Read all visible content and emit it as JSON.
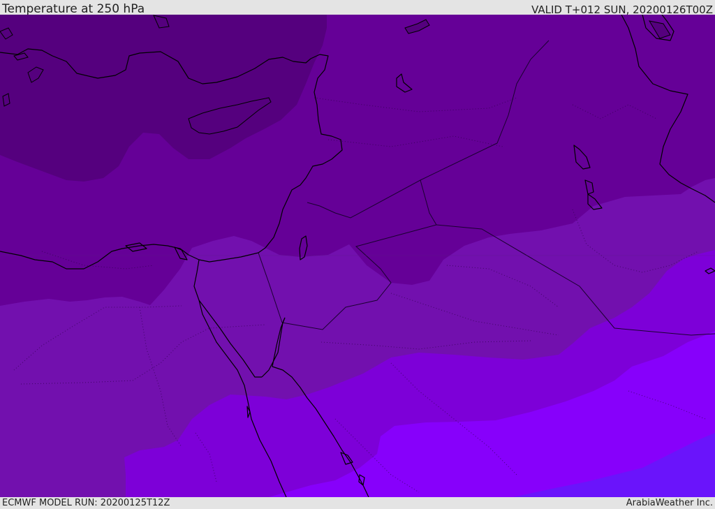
{
  "header": {
    "title": "Temperature at 250 hPa",
    "valid": "VALID T+012 SUN, 20200126T00Z"
  },
  "footer": {
    "model_run": "ECMWF MODEL RUN: 20200125T12Z",
    "credit": "ArabiaWeather Inc."
  },
  "map": {
    "field": "temperature",
    "level": "250 hPa",
    "region": "Eastern Mediterranean, Levant, Egypt and northern Arabia",
    "colors": {
      "band_1_coldest": "#55007e",
      "band_2": "#650097",
      "band_3": "#7210ae",
      "band_4": "#7d00d8",
      "band_5": "#8700fb",
      "band_6_warmest": "#6a14fb",
      "coastline": "#000000",
      "border": "#1a0030"
    }
  }
}
